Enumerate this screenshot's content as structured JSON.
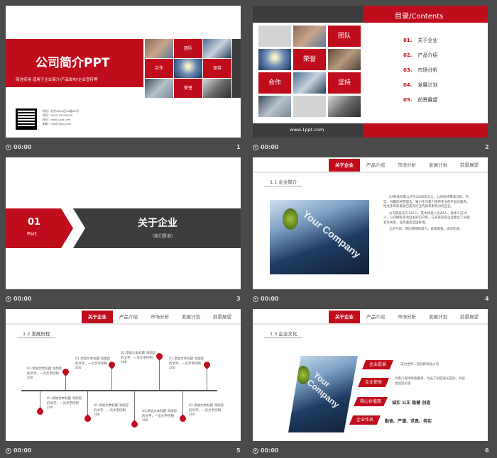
{
  "slide1": {
    "title": "公司简介PPT",
    "subtitle": "简洁实用 适用于企业简介/产品发布/企业宣传等",
    "tiles": [
      "团队",
      "合作",
      "坚持",
      "荣誉"
    ],
    "contact": [
      "地址：北京XXXX区XX路XX号",
      "电话：0000-12345678",
      "网址：www.1ppt.com",
      "邮箱：info@1ppt.com"
    ],
    "number": "1"
  },
  "slide2": {
    "title": "目录/Contents",
    "tiles": [
      "团队",
      "荣誉",
      "合作",
      "坚持"
    ],
    "url": "www.1ppt.com",
    "items": [
      {
        "n": "01.",
        "label": "关于企业"
      },
      {
        "n": "02.",
        "label": "产品介绍"
      },
      {
        "n": "03.",
        "label": "市场分析"
      },
      {
        "n": "04.",
        "label": "发展计划"
      },
      {
        "n": "05.",
        "label": "前景展望"
      }
    ],
    "number": "2"
  },
  "slide3": {
    "num": "01",
    "part": "Part",
    "title": "关于企业",
    "sub": "（我们是谁）",
    "number": "3"
  },
  "tabs": [
    "关于企业",
    "产品介绍",
    "市场分析",
    "发展计划",
    "前景展望"
  ],
  "slide4": {
    "section": "1.1 企业简介",
    "para1": "XX科技有限公司于2008年创立，公司始终秉承创新、务实、共赢的经营理念，致力于为客户提供专业的产品与服务，经过多年的发展已成为行业内具有影响力的企业。",
    "para2": "公司现有员工120人，其中研发人员20人，技术人员16人，公司拥有多项自主知识产权，与多家知名企业建立了长期合作关系，业务遍及全国各地。",
    "para3": "立足今日，我们将继续努力，奋发图强，再创佳绩。",
    "number": "4"
  },
  "slide5": {
    "section": "1.2 发展历程",
    "items": [
      "01.添加文本标题 添加您的文字，一页文字控制200",
      "01.添加文本标题 添加您的文字，一页文字控制200",
      "01.添加文本标题 添加您的文字，一页文字控制200",
      "01.添加文本标题 添加您的文字，一页文字控制200",
      "01.添加文本标题 添加您的文字，一页文字控制200",
      "01.添加文本标题 添加您的文字，一页文字控制200",
      "01.添加文本标题 添加您的文字，一页文字控制200",
      "01.添加文本标题 添加您的文字，一页文字控制200"
    ],
    "number": "5"
  },
  "slide6": {
    "section": "1.3 企业文化",
    "rows": [
      {
        "label": "企业愿景",
        "text": "成为世界一流创新科技公司"
      },
      {
        "label": "企业使命",
        "text": "为客户提供优质服务，为员工创造成长空间，为社会创造价值"
      },
      {
        "label": "核心价值观",
        "text": "诚实 公正 稳健 创造"
      },
      {
        "label": "企业作风",
        "text": "勤奋、严谨、求真、务实"
      }
    ],
    "number": "6"
  },
  "footer_time": "00:00",
  "colors": {
    "accent": "#c00d1c",
    "dark": "#3c3c3c",
    "bg": "#4a4a4a"
  }
}
